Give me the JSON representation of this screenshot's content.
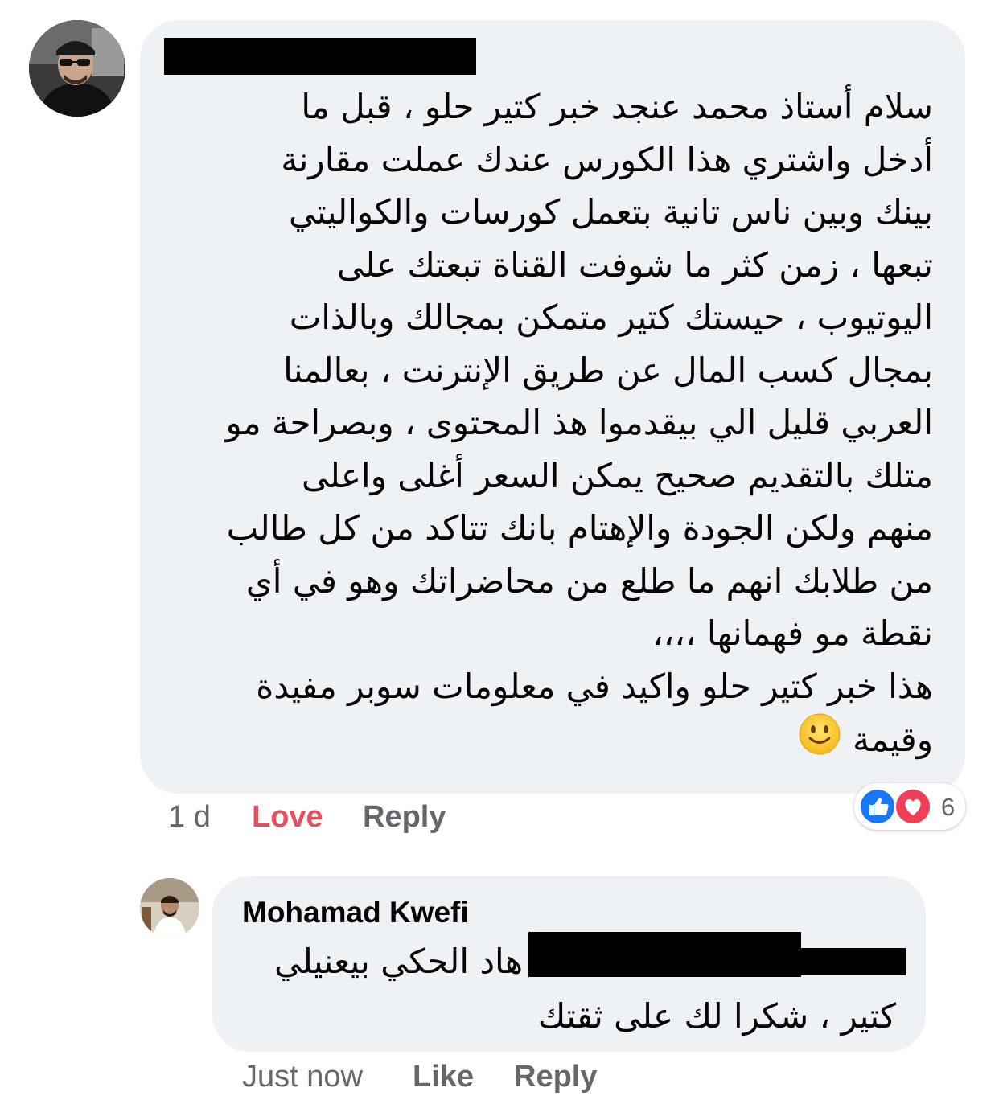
{
  "main_comment": {
    "author_avatar": "avatar-man-sunglasses",
    "text": "سلام أستاذ محمد عنجد خبر كتير حلو ، قبل ما\nأدخل واشتري هذا الكورس عندك عملت مقارنة\nبينك وبين ناس تانية بتعمل كورسات والكواليتي\nتبعها ، زمن كثر ما شوفت القناة تبعتك على\nاليوتيوب ، حيستك كتير متمكن بمجالك وبالذات\nبمجال كسب المال عن طريق الإنترنت ، بعالمنا\nالعربي قليل الي بيقدموا هذ المحتوى ، وبصراحة مو\nمتلك بالتقديم صحيح يمكن السعر أغلى واعلى\nمنهم ولكن الجودة والإهتام بانك تتاكد من كل طالب\nمن طلابك انهم ما طلع من محاضراتك وهو في أي\nنقطة مو فهمانها ،،،،\nهذا خبر كتير حلو واكيد في معلومات سوبر مفيدة",
    "last_line": "وقيمة",
    "emoji": "slightly-smiling-face",
    "time": "1 d",
    "love_label": "Love",
    "reply_label": "Reply",
    "reaction_icons": [
      "like-icon",
      "love-icon"
    ],
    "reaction_count": "6"
  },
  "reply_comment": {
    "author_avatar": "avatar-mohamad",
    "author": "Mohamad Kwefi",
    "text_line1": "هاد الحكي بيعنيلي",
    "text_line2": "كتير ، شكرا لك على ثقتك",
    "time": "Just now",
    "like_label": "Like",
    "reply_label": "Reply"
  },
  "colors": {
    "bubble": "#eff2f5",
    "love": "#e4505f",
    "meta": "#65676b",
    "like_blue": "#1877f2",
    "heart_red": "#f33e58"
  }
}
